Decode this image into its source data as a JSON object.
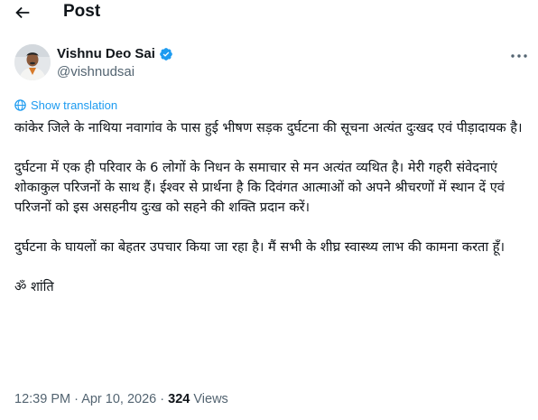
{
  "header": {
    "title": "Post",
    "back_icon": "arrow-left-icon"
  },
  "author": {
    "name": "Vishnu Deo Sai",
    "handle": "@vishnudsai",
    "verified_icon": "verified-badge-icon",
    "verified_color": "#1d9bf0",
    "more_icon": "more-horizontal-icon"
  },
  "translation": {
    "label": "Show translation",
    "icon": "globe-icon",
    "color": "#1d9bf0"
  },
  "post": {
    "paragraphs": [
      "कांकेर जिले के नाथिया नवागांव के पास हुई भीषण सड़क दुर्घटना की सूचना अत्यंत दुःखद एवं पीड़ादायक है।",
      "दुर्घटना में एक ही परिवार के 6 लोगों के निधन के समाचार से मन अत्यंत व्यथित है। मेरी गहरी संवेदनाएं शोकाकुल परिजनों के साथ हैं। ईश्वर से प्रार्थना है कि दिवंगत आत्माओं को अपने श्रीचरणों में स्थान दें एवं परिजनों को इस असहनीय दुःख को सहने की शक्ति प्रदान करें।",
      "दुर्घटना के घायलों का बेहतर उपचार किया जा रहा है। मैं सभी के शीघ्र स्वास्थ्य लाभ की कामना करता हूँ।",
      "ॐ शांति"
    ]
  },
  "meta": {
    "time": "12:39 PM",
    "separator": "·",
    "date": "Apr 10, 2026",
    "views_count": "324",
    "views_label": "Views"
  }
}
